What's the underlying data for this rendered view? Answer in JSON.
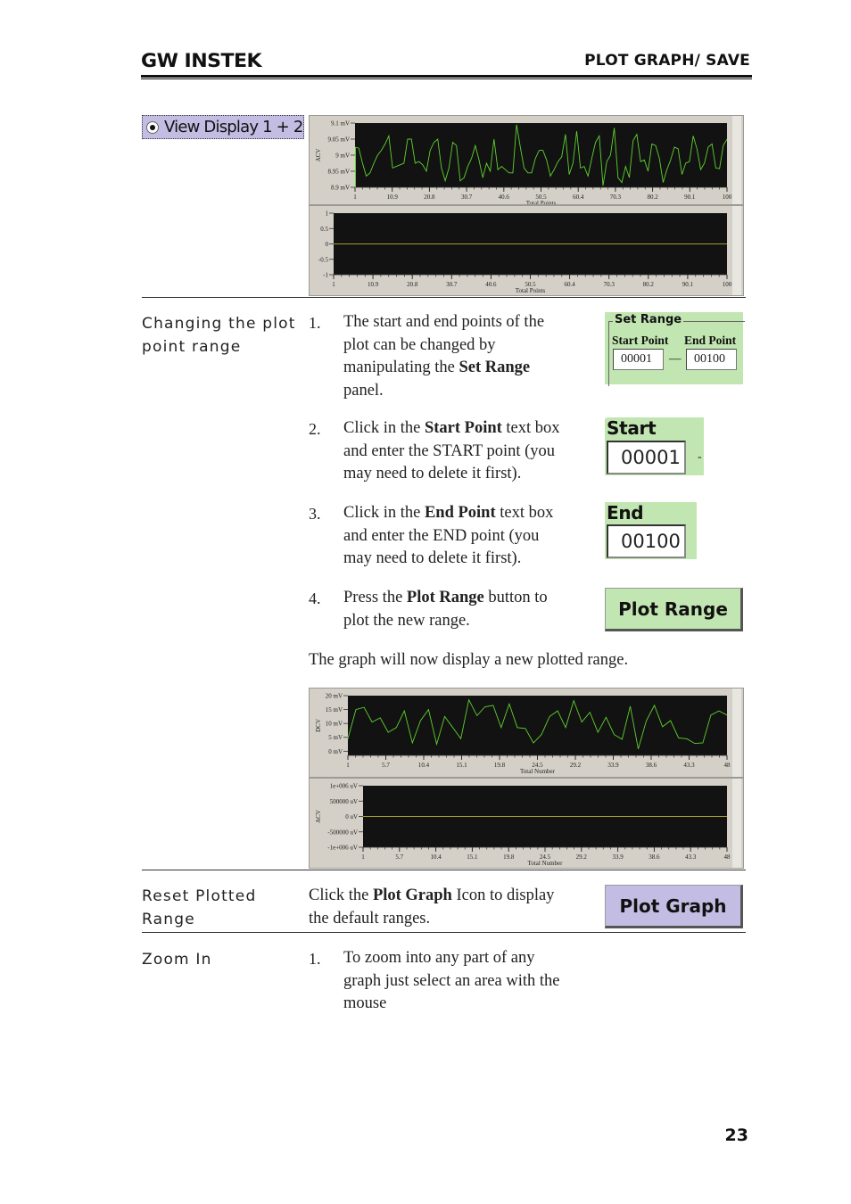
{
  "header": {
    "logo": "GW INSTEK",
    "title": "PLOT GRAPH/ SAVE"
  },
  "view_display": {
    "label": "View Display 1 + 2",
    "selected": true
  },
  "chart_data": [
    {
      "type": "line",
      "id": "top-upper",
      "title": "",
      "ylabel": "ACV",
      "xlabel": "Total Points",
      "ylim": [
        8.9,
        9.1
      ],
      "y_ticks": [
        "9.1 mV",
        "9.05 mV",
        "9 mV",
        "8.95 mV",
        "8.9 mV"
      ],
      "y_tick_values": [
        9.1,
        9.05,
        9.0,
        8.95,
        8.9
      ],
      "xlim": [
        1,
        100
      ],
      "x_ticks": [
        "1",
        "10.9",
        "20.8",
        "30.7",
        "40.6",
        "50.5",
        "60.4",
        "70.3",
        "80.2",
        "90.1",
        "100"
      ],
      "x_tick_values": [
        1,
        10.9,
        20.8,
        30.7,
        40.6,
        50.5,
        60.4,
        70.3,
        80.2,
        90.1,
        100
      ],
      "line_color": "#5fd12f",
      "grid": false,
      "series": [
        {
          "name": "ACV",
          "x_start": 1,
          "x_step": 1,
          "values": [
            9.025,
            9.022,
            8.975,
            8.935,
            8.945,
            8.975,
            9.0,
            9.015,
            9.035,
            9.06,
            8.96,
            8.965,
            8.97,
            8.975,
            9.05,
            9.05,
            8.975,
            8.98,
            8.97,
            8.95,
            9.015,
            9.04,
            9.05,
            8.96,
            8.92,
            8.96,
            9.04,
            9.03,
            8.92,
            8.93,
            8.965,
            8.99,
            9.03,
            8.985,
            8.93,
            8.975,
            8.95,
            9.05,
            8.955,
            8.965,
            8.955,
            8.945,
            8.945,
            9.095,
            9.025,
            8.96,
            8.945,
            8.945,
            8.99,
            9.015,
            9.015,
            8.985,
            8.935,
            8.955,
            8.98,
            8.995,
            9.065,
            8.94,
            8.975,
            9.075,
            8.96,
            8.965,
            8.935,
            8.99,
            9.04,
            9.06,
            8.905,
            8.98,
            9.0,
            9.085,
            8.93,
            8.915,
            8.965,
            8.93,
            9.045,
            9.065,
            8.98,
            8.985,
            8.95,
            9.035,
            9.03,
            8.99,
            8.915,
            8.955,
            8.985,
            9.025,
            9.02,
            8.94,
            8.975,
            8.98,
            9.06,
            9.02,
            8.955,
            8.975,
            9.025,
            9.035,
            8.96,
            8.958,
            9.03,
            9.05
          ]
        }
      ]
    },
    {
      "type": "line",
      "id": "top-lower",
      "ylabel": "",
      "xlabel": "Total Points",
      "ylim": [
        -1,
        1
      ],
      "y_ticks": [
        "1",
        "0.5",
        "0",
        "-0.5",
        "-1"
      ],
      "y_tick_values": [
        1,
        0.5,
        0,
        -0.5,
        -1
      ],
      "xlim": [
        1,
        100
      ],
      "x_ticks": [
        "1",
        "10.9",
        "20.8",
        "30.7",
        "40.6",
        "50.5",
        "60.4",
        "70.3",
        "80.2",
        "90.1",
        "100"
      ],
      "x_tick_values": [
        1,
        10.9,
        20.8,
        30.7,
        40.6,
        50.5,
        60.4,
        70.3,
        80.2,
        90.1,
        100
      ],
      "line_color": "#a59a2a",
      "grid": false,
      "series": [
        {
          "name": "flat",
          "x_start": 1,
          "x_step": 99,
          "values": [
            0,
            0
          ]
        }
      ]
    },
    {
      "type": "line",
      "id": "bottom-upper",
      "ylabel": "DCV",
      "xlabel": "Total Number",
      "ylim": [
        -1.5,
        20
      ],
      "y_ticks": [
        "20 mV",
        "15 mV",
        "10 mV",
        "5 mV",
        "0 mV"
      ],
      "y_tick_values": [
        20,
        15,
        10,
        5,
        0
      ],
      "xlim": [
        1,
        48
      ],
      "x_ticks": [
        "1",
        "5.7",
        "10.4",
        "15.1",
        "19.8",
        "24.5",
        "29.2",
        "33.9",
        "38.6",
        "43.3",
        "48"
      ],
      "x_tick_values": [
        1,
        5.7,
        10.4,
        15.1,
        19.8,
        24.5,
        29.2,
        33.9,
        38.6,
        43.3,
        48
      ],
      "line_color": "#5fd12f",
      "grid": false,
      "series": [
        {
          "name": "DCV",
          "x_start": 1,
          "x_step": 1,
          "values": [
            4.5,
            15.0,
            15.8,
            10.5,
            12.0,
            6.8,
            8.5,
            14.5,
            3.0,
            11.0,
            15.0,
            2.5,
            12.5,
            8.5,
            4.5,
            18.5,
            12.8,
            16.0,
            16.5,
            8.5,
            17.0,
            8.5,
            8.2,
            3.0,
            6.0,
            12.5,
            14.5,
            8.5,
            18.2,
            10.5,
            14.0,
            6.8,
            12.2,
            6.0,
            4.3,
            16.2,
            0.8,
            11.0,
            16.5,
            8.8,
            11.0,
            4.8,
            4.5,
            2.8,
            3.0,
            13.0,
            14.5,
            13.0
          ]
        }
      ]
    },
    {
      "type": "line",
      "id": "bottom-lower",
      "ylabel": "ACV",
      "xlabel": "Total Number",
      "ylim": [
        -1000000,
        1000000
      ],
      "y_ticks": [
        "1e+006 uV",
        "500000 uV",
        "0 uV",
        "-500000 uV",
        "-1e+006 uV"
      ],
      "y_tick_values": [
        1000000,
        500000,
        0,
        -500000,
        -1000000
      ],
      "xlim": [
        1,
        48
      ],
      "x_ticks": [
        "1",
        "5.7",
        "10.4",
        "15.1",
        "19.8",
        "24.5",
        "29.2",
        "33.9",
        "38.6",
        "43.3",
        "48"
      ],
      "x_tick_values": [
        1,
        5.7,
        10.4,
        15.1,
        19.8,
        24.5,
        29.2,
        33.9,
        38.6,
        43.3,
        48
      ],
      "line_color": "#a59a2a",
      "grid": false,
      "series": [
        {
          "name": "flat",
          "x_start": 1,
          "x_step": 47,
          "values": [
            0,
            0
          ]
        }
      ]
    }
  ],
  "sections": {
    "changing_range": {
      "label_line1": "Changing the plot",
      "label_line2": "point range",
      "steps": [
        {
          "num": "1.",
          "lines": [
            "The start and end points of  the",
            "plot can be changed by"
          ],
          "line3_pre": "manipulating the ",
          "line3_bold": "Set Range",
          "line4": "panel."
        },
        {
          "num": "2.",
          "line1_pre": "Click in the ",
          "line1_bold": "Start Point",
          "line1_post": " text box",
          "line2": "and enter the START point (you",
          "line3": "may need to delete it first)."
        },
        {
          "num": "3.",
          "line1_pre": "Click in the ",
          "line1_bold": "End Point",
          "line1_post": " text box",
          "line2": "and enter the END point (you",
          "line3": "may need to delete it first)."
        },
        {
          "num": "4.",
          "line1_pre": "Press the ",
          "line1_bold": "Plot Range",
          "line1_post": " button to",
          "line2": "plot the new range."
        }
      ],
      "result_text": "The graph will now display a new plotted range."
    },
    "reset": {
      "label_line1": "Reset Plotted",
      "label_line2": "Range",
      "line1_pre": "Click the ",
      "line1_bold": "Plot Graph",
      "line1_post": " Icon to display",
      "line2": "the default ranges."
    },
    "zoom_in": {
      "label": "Zoom In",
      "num": "1.",
      "lines": [
        "To zoom into any part of  any",
        "graph just select an area with the",
        "mouse"
      ]
    }
  },
  "set_range_panel": {
    "title": "Set Range",
    "start_label": "Start Point",
    "end_label": "End Point",
    "start_value": "00001",
    "end_value": "00100",
    "separator": "—"
  },
  "buttons": {
    "plot_range": "Plot Range",
    "plot_graph": "Plot Graph"
  },
  "page_number": "23"
}
